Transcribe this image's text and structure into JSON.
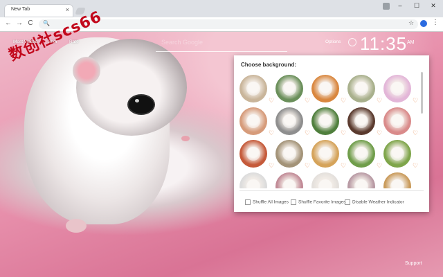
{
  "browser": {
    "tab_title": "New Tab",
    "tab_close": "×",
    "win_min": "–",
    "win_max": "☐",
    "win_close": "✕",
    "back": "←",
    "forward": "→",
    "reload": "C",
    "search_icon": "🔍",
    "star_icon": "☆",
    "menu_icon": "⋮"
  },
  "page": {
    "most_visited": "Most Visited",
    "shortcuts": "Shor",
    "rate": "Rate",
    "search_placeholder": "Search Google",
    "options": "Options",
    "clock": "11:35",
    "ampm": "AM",
    "date": "",
    "watermark": "数创社scs66",
    "support": "Support"
  },
  "panel": {
    "title": "Choose background:",
    "heart_icon": "♡",
    "thumbs": [
      {
        "color": "#c9b59a"
      },
      {
        "color": "#6a8f5a"
      },
      {
        "color": "#d9873f"
      },
      {
        "color": "#a8b08c"
      },
      {
        "color": "#e3b6d8"
      },
      {
        "color": "#d69b7a"
      },
      {
        "color": "#8e8e8e"
      },
      {
        "color": "#4f7f3d"
      },
      {
        "color": "#5a3a2e"
      },
      {
        "color": "#d98a8a"
      },
      {
        "color": "#c55a3a"
      },
      {
        "color": "#a39378"
      },
      {
        "color": "#d5a35a"
      },
      {
        "color": "#6f9d4a"
      },
      {
        "color": "#7ea54a"
      },
      {
        "color": "#dcdcdc"
      },
      {
        "color": "#c18a96"
      },
      {
        "color": "#e4e0dc"
      },
      {
        "color": "#b89aa4"
      },
      {
        "color": "#c99a5a"
      }
    ],
    "options": [
      "Shuffle All Images",
      "Shuffle Favorite Images",
      "Disable Weather Indicator"
    ]
  }
}
